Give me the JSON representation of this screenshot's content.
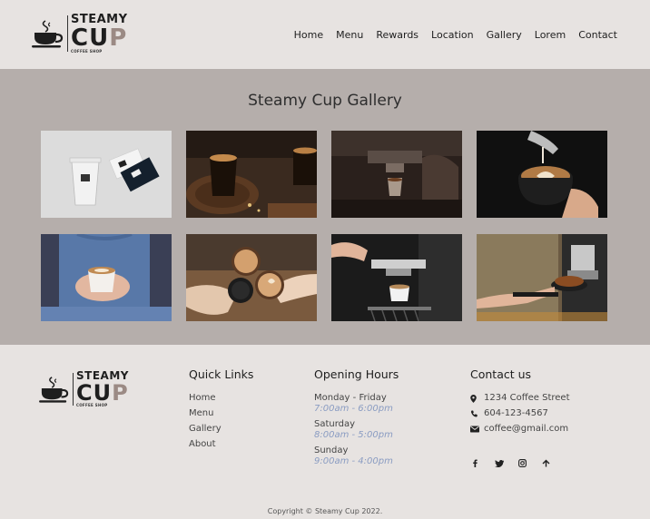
{
  "brand": {
    "line1": "STEAMY",
    "line2_c": "CU",
    "line2_p": "P",
    "line3": "COFFEE SHOP"
  },
  "nav": {
    "items": [
      "Home",
      "Menu",
      "Rewards",
      "Location",
      "Gallery",
      "Lorem",
      "Contact"
    ]
  },
  "gallery": {
    "title": "Steamy Cup Gallery",
    "images": [
      "branded-cups-and-cards-image",
      "espresso-glass-on-wood-image",
      "espresso-extraction-image",
      "latte-art-pour-image",
      "woman-holding-cappuccino-image",
      "cups-toast-image",
      "espresso-machine-image",
      "grinder-portafilter-image"
    ]
  },
  "footer": {
    "quick_links": {
      "title": "Quick Links",
      "items": [
        "Home",
        "Menu",
        "Gallery",
        "About"
      ]
    },
    "hours": {
      "title": "Opening Hours",
      "entries": [
        {
          "day": "Monday - Friday",
          "time": "7:00am - 6:00pm"
        },
        {
          "day": "Saturday",
          "time": "8:00am - 5:00pm"
        },
        {
          "day": "Sunday",
          "time": "9:00am - 4:00pm"
        }
      ]
    },
    "contact": {
      "title": "Contact us",
      "address": "1234 Coffee Street",
      "phone": "604-123-4567",
      "email": "coffee@gmail.com",
      "icons": [
        "map-marker-icon",
        "phone-icon",
        "envelope-icon"
      ]
    },
    "social": [
      "facebook-icon",
      "twitter-icon",
      "instagram-icon",
      "arrow-up-icon"
    ],
    "copyright": "Copyright © Steamy Cup 2022."
  },
  "colors": {
    "header_bg": "#e7e3e1",
    "gallery_bg": "#b5aeab",
    "accent_time": "#8a9cc2",
    "brand_p": "#9b8a84"
  }
}
